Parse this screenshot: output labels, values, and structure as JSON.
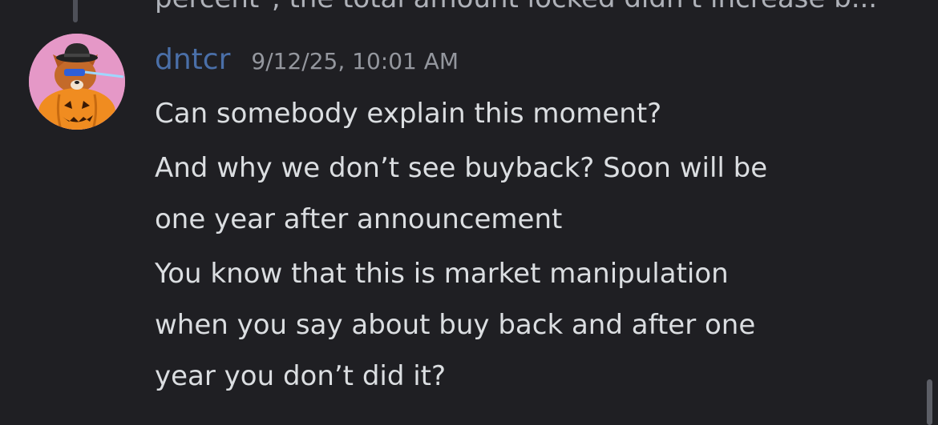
{
  "previous_message": {
    "text": "percent\", the total amount locked didn't increase b..."
  },
  "message": {
    "username": "dntcr",
    "timestamp": "9/12/25, 10:01 AM",
    "lines": [
      "Can somebody explain this moment?",
      "And why we don’t see buyback? Soon will be",
      "one year after announcement",
      "You know that this is market manipulation",
      "when you say about buy back and after one",
      "year you don’t did it?"
    ]
  },
  "colors": {
    "background": "#1f1f23",
    "username": "#4a6fa8",
    "timestamp": "#94979e",
    "text": "#dbdee1",
    "avatar_bg": "#e598c7"
  },
  "icons": {
    "avatar": "pumpkin-fox-avatar-icon"
  }
}
